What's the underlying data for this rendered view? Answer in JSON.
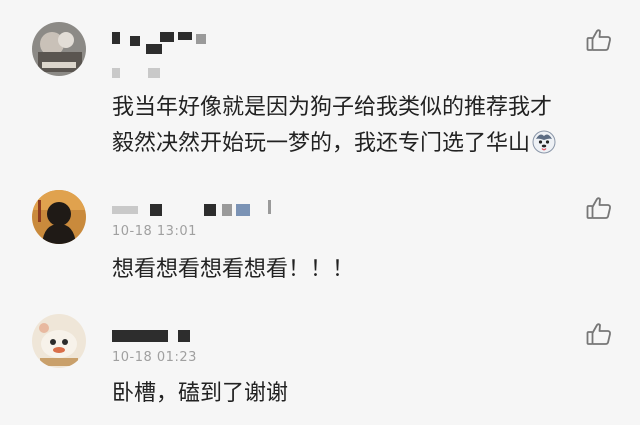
{
  "comments": [
    {
      "text_line1": "我当年好像就是因为狗子给我类似的推荐我才",
      "text_line2": "毅然决然开始玩一梦的，我还专门选了华山",
      "emoji": "husky-face-icon"
    },
    {
      "time": "10-18 13:01",
      "text": "想看想看想看想看！！！"
    },
    {
      "time": "10-18 01:23",
      "text": "卧槽，磕到了谢谢"
    }
  ],
  "icons": {
    "like": "thumbs-up-icon"
  },
  "colors": {
    "background": "#f6f6f6",
    "text": "#222222",
    "meta": "#a0a0a0",
    "divider": "#e4e4e4"
  }
}
